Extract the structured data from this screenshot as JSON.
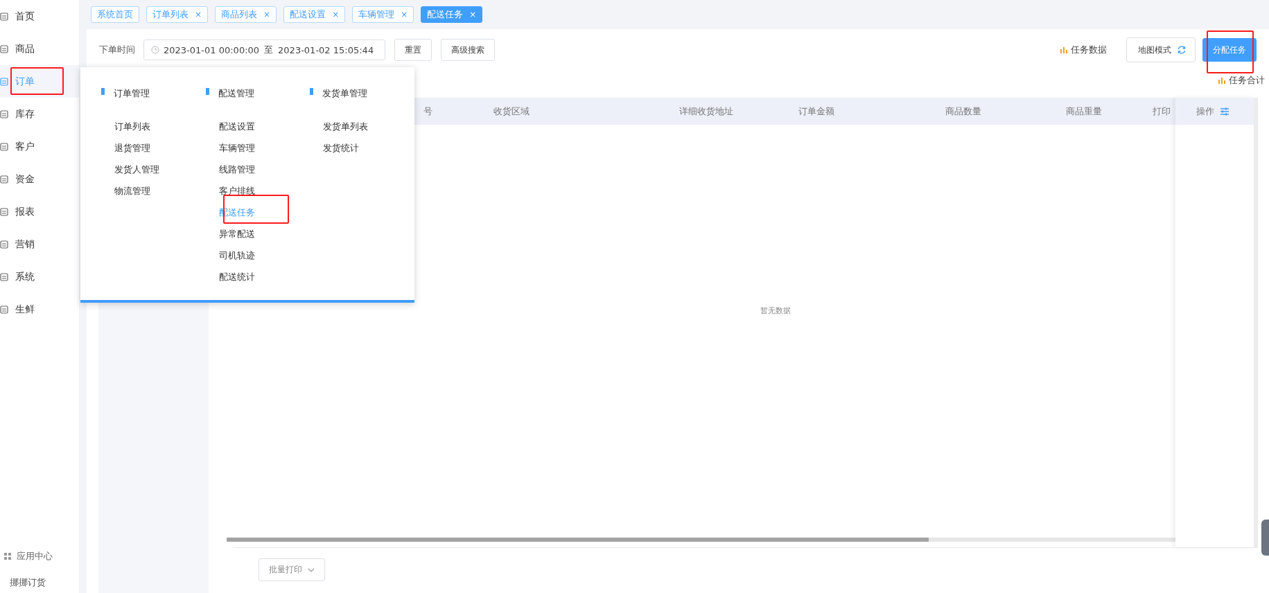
{
  "sidebar": {
    "items": [
      {
        "label": "首页",
        "selected": false
      },
      {
        "label": "商品",
        "selected": false
      },
      {
        "label": "订单",
        "selected": true
      },
      {
        "label": "库存",
        "selected": false
      },
      {
        "label": "客户",
        "selected": false
      },
      {
        "label": "资金",
        "selected": false
      },
      {
        "label": "报表",
        "selected": false
      },
      {
        "label": "营销",
        "selected": false
      },
      {
        "label": "系统",
        "selected": false
      },
      {
        "label": "生鲜",
        "selected": false
      }
    ],
    "apps_label": "应用中心",
    "brand": "挪挪订货"
  },
  "tabs": [
    {
      "label": "系统首页",
      "selected": false,
      "closable": false
    },
    {
      "label": "订单列表",
      "selected": false,
      "closable": true,
      "close": "×"
    },
    {
      "label": "商品列表",
      "selected": false,
      "closable": true,
      "close": "×"
    },
    {
      "label": "配送设置",
      "selected": false,
      "closable": true,
      "close": "×"
    },
    {
      "label": "车辆管理",
      "selected": false,
      "closable": true,
      "close": "×"
    },
    {
      "label": "配送任务",
      "selected": true,
      "closable": true,
      "close": "×"
    }
  ],
  "filter": {
    "label": "下单时间",
    "start": "2023-01-01 00:00:00",
    "separator": "至",
    "end": "2023-01-02 15:05:44",
    "buttons": [
      "重置",
      "高级搜索"
    ]
  },
  "toolbar": {
    "stats_link": "任务数据",
    "map_button": "地图模式",
    "assign_button": "分配任务",
    "total_link": "任务合计"
  },
  "table": {
    "columns": [
      "号",
      "收货区域",
      "详细收货地址",
      "订单金额",
      "商品数量",
      "商品重量",
      "打印"
    ],
    "action_column": "操作",
    "empty_text": "暂无数据"
  },
  "batch_button": "批量打印",
  "menu": {
    "groups": [
      {
        "title": "订单管理",
        "items": [
          {
            "label": "订单列表",
            "selected": false
          },
          {
            "label": "退货管理",
            "selected": false
          },
          {
            "label": "发货人管理",
            "selected": false
          },
          {
            "label": "物流管理",
            "selected": false
          }
        ]
      },
      {
        "title": "配送管理",
        "items": [
          {
            "label": "配送设置",
            "selected": false
          },
          {
            "label": "车辆管理",
            "selected": false
          },
          {
            "label": "线路管理",
            "selected": false
          },
          {
            "label": "客户排线",
            "selected": false
          },
          {
            "label": "配送任务",
            "selected": true
          },
          {
            "label": "异常配送",
            "selected": false
          },
          {
            "label": "司机轨迹",
            "selected": false
          },
          {
            "label": "配送统计",
            "selected": false
          }
        ]
      },
      {
        "title": "发货单管理",
        "items": [
          {
            "label": "发货单列表",
            "selected": false
          },
          {
            "label": "发货统计",
            "selected": false
          }
        ]
      }
    ]
  }
}
